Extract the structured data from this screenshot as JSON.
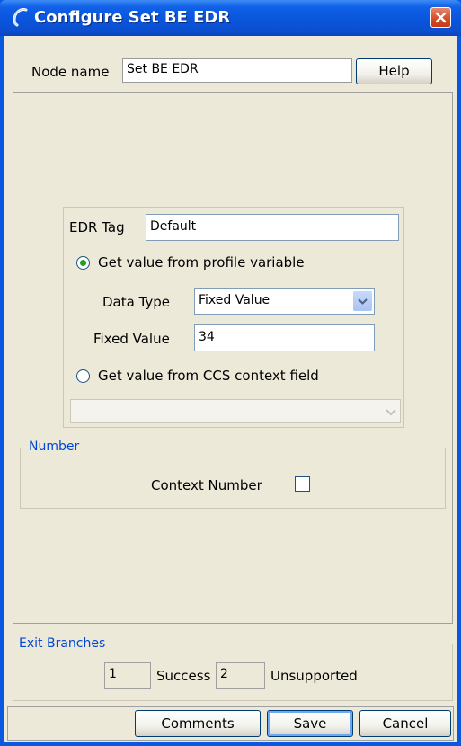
{
  "window": {
    "title": "Configure Set BE EDR"
  },
  "header": {
    "node_name_label": "Node name",
    "node_name_value": "Set BE EDR",
    "help_label": "Help"
  },
  "edr": {
    "tag_label": "EDR Tag",
    "tag_value": "Default",
    "option_profile_label": "Get value from profile variable",
    "option_profile_selected": true,
    "data_type_label": "Data Type",
    "data_type_value": "Fixed Value",
    "fixed_value_label": "Fixed Value",
    "fixed_value": "34",
    "option_context_label": "Get value from CCS context field",
    "option_context_selected": false,
    "context_field_value": ""
  },
  "number": {
    "legend": "Number",
    "context_number_label": "Context Number",
    "context_number_checked": false
  },
  "exit_branches": {
    "legend": "Exit Branches",
    "branches": [
      {
        "number": "1",
        "label": "Success"
      },
      {
        "number": "2",
        "label": "Unsupported"
      }
    ]
  },
  "footer": {
    "comments_label": "Comments",
    "save_label": "Save",
    "cancel_label": "Cancel"
  },
  "colors": {
    "title_bar": "#0a55dc",
    "dialog_bg": "#ece9d8",
    "close_button": "#d24a26",
    "legend_text": "#0046d5"
  }
}
